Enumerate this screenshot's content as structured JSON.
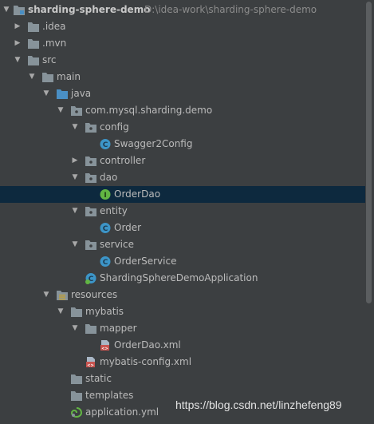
{
  "project": {
    "name": "sharding-sphere-demo",
    "path": "D:\\idea-work\\sharding-sphere-demo"
  },
  "tree": {
    "idea": ".idea",
    "mvn": ".mvn",
    "src": "src",
    "main": "main",
    "java": "java",
    "package": "com.mysql.sharding.demo",
    "config": "config",
    "swagger": "Swagger2Config",
    "controller": "controller",
    "dao": "dao",
    "order_dao": "OrderDao",
    "entity": "entity",
    "order": "Order",
    "service": "service",
    "order_service": "OrderService",
    "app": "ShardingSphereDemoApplication",
    "resources": "resources",
    "mybatis": "mybatis",
    "mapper": "mapper",
    "order_dao_xml": "OrderDao.xml",
    "mybatis_config": "mybatis-config.xml",
    "static": "static",
    "templates": "templates",
    "app_yml": "application.yml"
  },
  "icons": {
    "class_letter": "C",
    "interface_letter": "I",
    "xml_mark": "<>"
  },
  "colors": {
    "background": "#3c3f41",
    "selection": "#0d293e",
    "folder": "#87939a",
    "source_folder": "#4a8fc4",
    "class_icon": "#3c95c8",
    "interface_icon": "#62b543"
  },
  "watermark": "https://blog.csdn.net/linzhefeng89"
}
